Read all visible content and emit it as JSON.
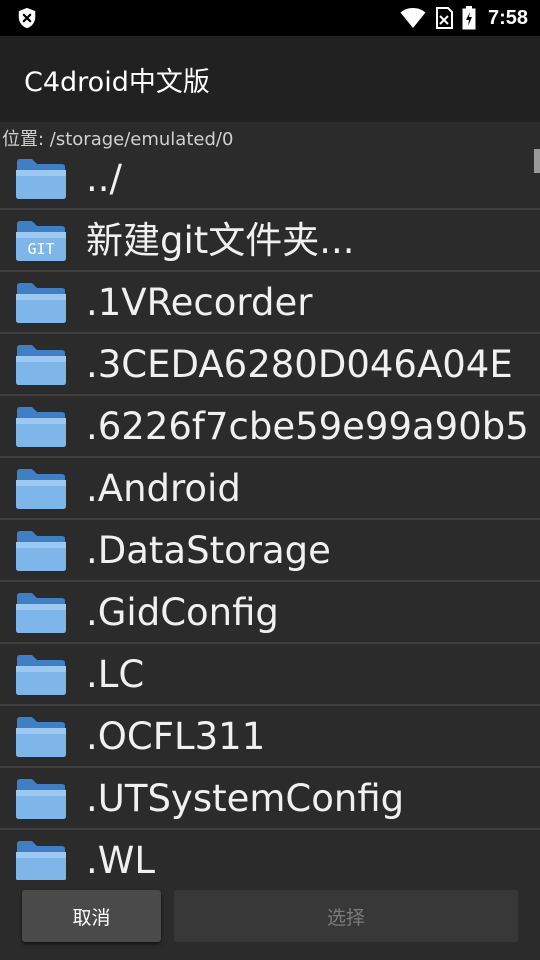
{
  "status_bar": {
    "time": "7:58",
    "icons": [
      "shield-close-icon",
      "wifi-icon",
      "no-sim-icon",
      "battery-icon"
    ]
  },
  "app": {
    "title": "C4droid中文版"
  },
  "location": {
    "text": "位置: /storage/emulated/0"
  },
  "files": [
    {
      "name": "../",
      "icon": "folder-icon"
    },
    {
      "name": "新建git文件夹...",
      "icon": "git-folder-icon"
    },
    {
      "name": ".1VRecorder",
      "icon": "folder-icon"
    },
    {
      "name": ".3CEDA6280D046A04E",
      "icon": "folder-icon"
    },
    {
      "name": ".6226f7cbe59e99a90b5",
      "icon": "folder-icon"
    },
    {
      "name": ".Android",
      "icon": "folder-icon"
    },
    {
      "name": ".DataStorage",
      "icon": "folder-icon"
    },
    {
      "name": ".GidConfig",
      "icon": "folder-icon"
    },
    {
      "name": ".LC",
      "icon": "folder-icon"
    },
    {
      "name": ".OCFL311",
      "icon": "folder-icon"
    },
    {
      "name": ".UTSystemConfig",
      "icon": "folder-icon"
    },
    {
      "name": ".WL",
      "icon": "folder-icon"
    }
  ],
  "buttons": {
    "cancel": "取消",
    "select": "选择"
  },
  "git_badge": "GIT",
  "colors": {
    "folder": "#6fa7dc",
    "background": "#2b2b2b",
    "title_bar": "#212121"
  }
}
